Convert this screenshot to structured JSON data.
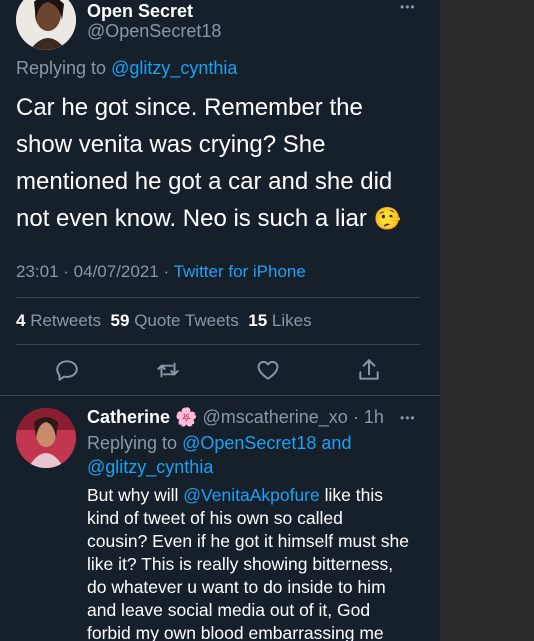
{
  "main_tweet": {
    "author_name": "Open Secret",
    "author_handle": "@OpenSecret18",
    "replying_prefix": "Replying to ",
    "replying_to": "@glitzy_cynthia",
    "text_lines": [
      "Car he got since. Remember the",
      "show venita was crying? She",
      "mentioned he got a car and she did",
      "not even know. Neo is such a liar"
    ],
    "emoji": "🤥",
    "time": "23:01",
    "date": "04/07/2021",
    "sep": " · ",
    "source": "Twitter for iPhone",
    "stats": {
      "retweets_count": "4",
      "retweets_label": "Retweets",
      "quotes_count": "59",
      "quotes_label": "Quote Tweets",
      "likes_count": "15",
      "likes_label": "Likes"
    },
    "more": "•••"
  },
  "actions": [
    "reply-icon",
    "retweet-icon",
    "like-icon",
    "share-icon"
  ],
  "reply_tweet": {
    "author_name": "Catherine",
    "flower": "🌸",
    "author_handle": "@mscatherine_xo",
    "age": "1h",
    "more": "•••",
    "replying_prefix": "Replying to ",
    "replying_to_1": "@OpenSecret18",
    "and": " and",
    "replying_to_2": "@glitzy_cynthia",
    "text_line1_pre": "But why will ",
    "mention": "@VenitaAkpofure",
    "text_line1_post": " like this",
    "text_lines": [
      "kind of tweet of his own so called",
      "cousin? Even if he got it himself must she",
      "like it? This is really showing bitterness,",
      "do whatever u want to do inside to him",
      "and leave social media out of it, God",
      "forbid my own blood embarrassing me"
    ]
  },
  "colors": {
    "background": "#15202b",
    "accent": "#1da1f2",
    "muted": "#8899a6",
    "divider": "#38444d"
  }
}
